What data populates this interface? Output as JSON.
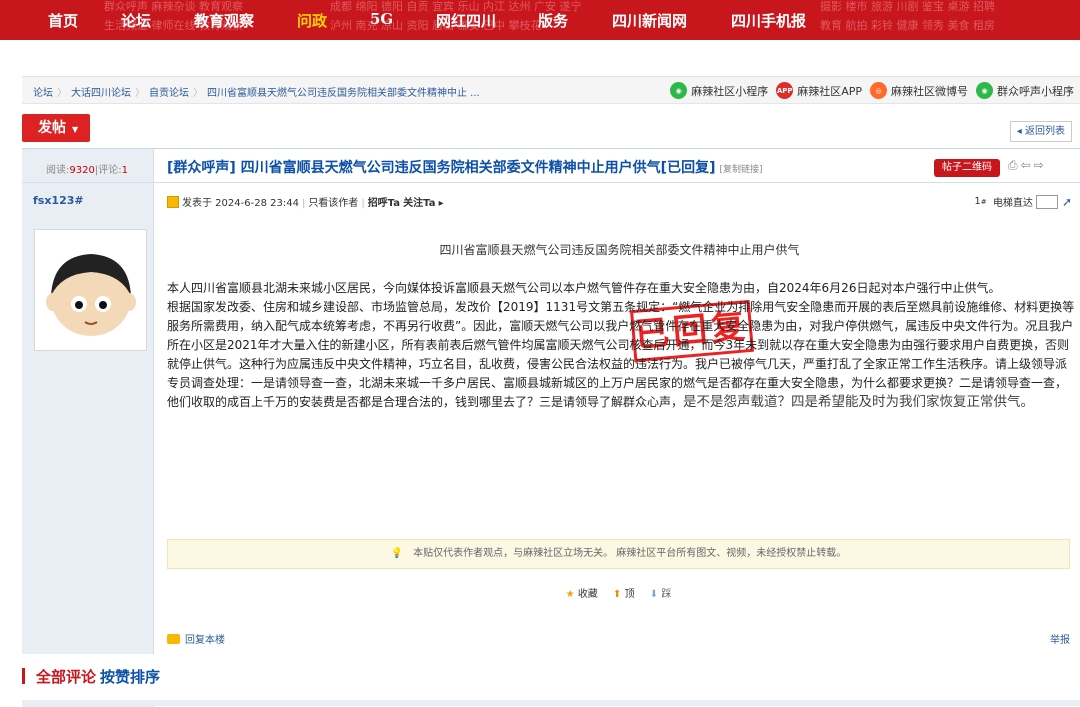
{
  "nav": {
    "items": [
      {
        "label": "首页",
        "active": false
      },
      {
        "label": "论坛",
        "active": false
      },
      {
        "label": "教育观察",
        "active": false
      },
      {
        "label": "问政",
        "active": true
      },
      {
        "label": "5G",
        "active": false
      },
      {
        "label": "网红四川",
        "active": false
      },
      {
        "label": "版务",
        "active": false
      },
      {
        "label": "四川新闻网",
        "active": false
      },
      {
        "label": "四川手机报",
        "active": false
      }
    ],
    "ghost_text": [
      "群众呼声 麻辣杂谈 教育观察",
      "生活频道 律师在线 教育观察",
      "成都 绵阳 德阳 自贡 宜宾 乐山 内江 达州 广安 遂宁",
      "泸州 南充 凉山 资阳 眉山 雅安 巴中 攀枝花",
      "摄影 楼市 旅游 川剧 鉴宝 桌游 招聘",
      "教育 航拍 彩铃 健康 领秀 美食 租房"
    ]
  },
  "breadcrumb": [
    "论坛",
    "大话四川论坛",
    "自贡论坛",
    "四川省富顺县天燃气公司违反国务院相关部委文件精神中止 ..."
  ],
  "top_links": [
    {
      "label": "麻辣社区小程序",
      "icon": "wechat-miniprogram-icon",
      "color": "#2fb84a"
    },
    {
      "label": "麻辣社区APP",
      "icon": "app-icon",
      "color": "#e02b2b",
      "badge": "APP"
    },
    {
      "label": "麻辣社区微博号",
      "icon": "weibo-icon",
      "color": "#ff6a2a"
    },
    {
      "label": "群众呼声小程序",
      "icon": "wechat-miniprogram-icon",
      "color": "#2fb84a"
    }
  ],
  "toolbar": {
    "post_label": "发帖",
    "back_label": "◂ 返回列表"
  },
  "thread": {
    "reads_label": "阅读:",
    "reads": "9320",
    "comments_label": "评论:",
    "comments": "1",
    "title": "[群众呼声] 四川省富顺县天燃气公司违反国务院相关部委文件精神中止用户供气[已回复]",
    "copy_link": "[复制链接]",
    "qr_label": "帖子二维码",
    "stamp": "已回复"
  },
  "post": {
    "author": "fsx123#",
    "meta_posted": "发表于 2024-6-28 23:44",
    "meta_only_author": "只看该作者",
    "meta_greet": "招呼Ta",
    "meta_follow": "关注Ta",
    "floor": "1",
    "floor_sup": "#",
    "elevator": "电梯直达",
    "doc_title": "四川省富顺县天燃气公司违反国务院相关部委文件精神中止用户供气",
    "para1": "本人四川省富顺县北湖未来城小区居民，今向媒体投诉富顺县天燃气公司以本户燃气管件存在重大安全隐患为由，自2024年6月26日起对本户强行中止供气。",
    "para2_main": "  根据国家发改委、住房和城乡建设部、市场监管总局，发改价【2019】1131号文第五条规定：“燃气企业为排除用气安全隐患而开展的表后至燃具前设施维修、材料更换等服务所需费用，纳入配气成本统筹考虑，不再另行收费”。因此，富顺天燃气公司以我户燃气管件存在重大安全隐患为由，对我户停供燃气，属违反中央文件行为。况且我户所在小区是2021年才大量入住的新建小区，所有表前表后燃气管件均属富顺天燃气公司核查后开通，而今3年未到就以存在重大安全隐患为由强行要求用户自费更换，否则就停止供气。这种行为应属违反中央文件精神，巧立名目，乱收费，侵害公民合法权益的违法行为。我户已被停气几天，严重打乱了全家正常工作生活秩序。请上级领导派专员调查处理：一是请领导查一查，北湖未来城一千多户居民、富顺县城新城区的上万户居民家的燃气是否都存在重大安全隐患，为什么都要求更换？二是请领导查一查，他们收取的成百上千万的安装费是否都是合理合法的，钱到哪里去了？三是请领导了解群众心声，",
    "para2_tail": "是不是怨声载道？四是希望能及时为我们家恢复正常供气。",
    "notice": "本贴仅代表作者观点，与麻辣社区立场无关。 麻辣社区平台所有图文、视频，未经授权禁止转载。",
    "actions": {
      "favorite": "收藏",
      "up": "顶",
      "down": "踩"
    },
    "reply": "回复本楼",
    "report": "举报"
  },
  "comments": {
    "title": "全部评论",
    "sort": "按赞排序"
  },
  "colors": {
    "brand_red": "#c8161d",
    "link_blue": "#2b5a9c",
    "title_blue": "#0d50a8",
    "active_nav": "#ffd200"
  }
}
